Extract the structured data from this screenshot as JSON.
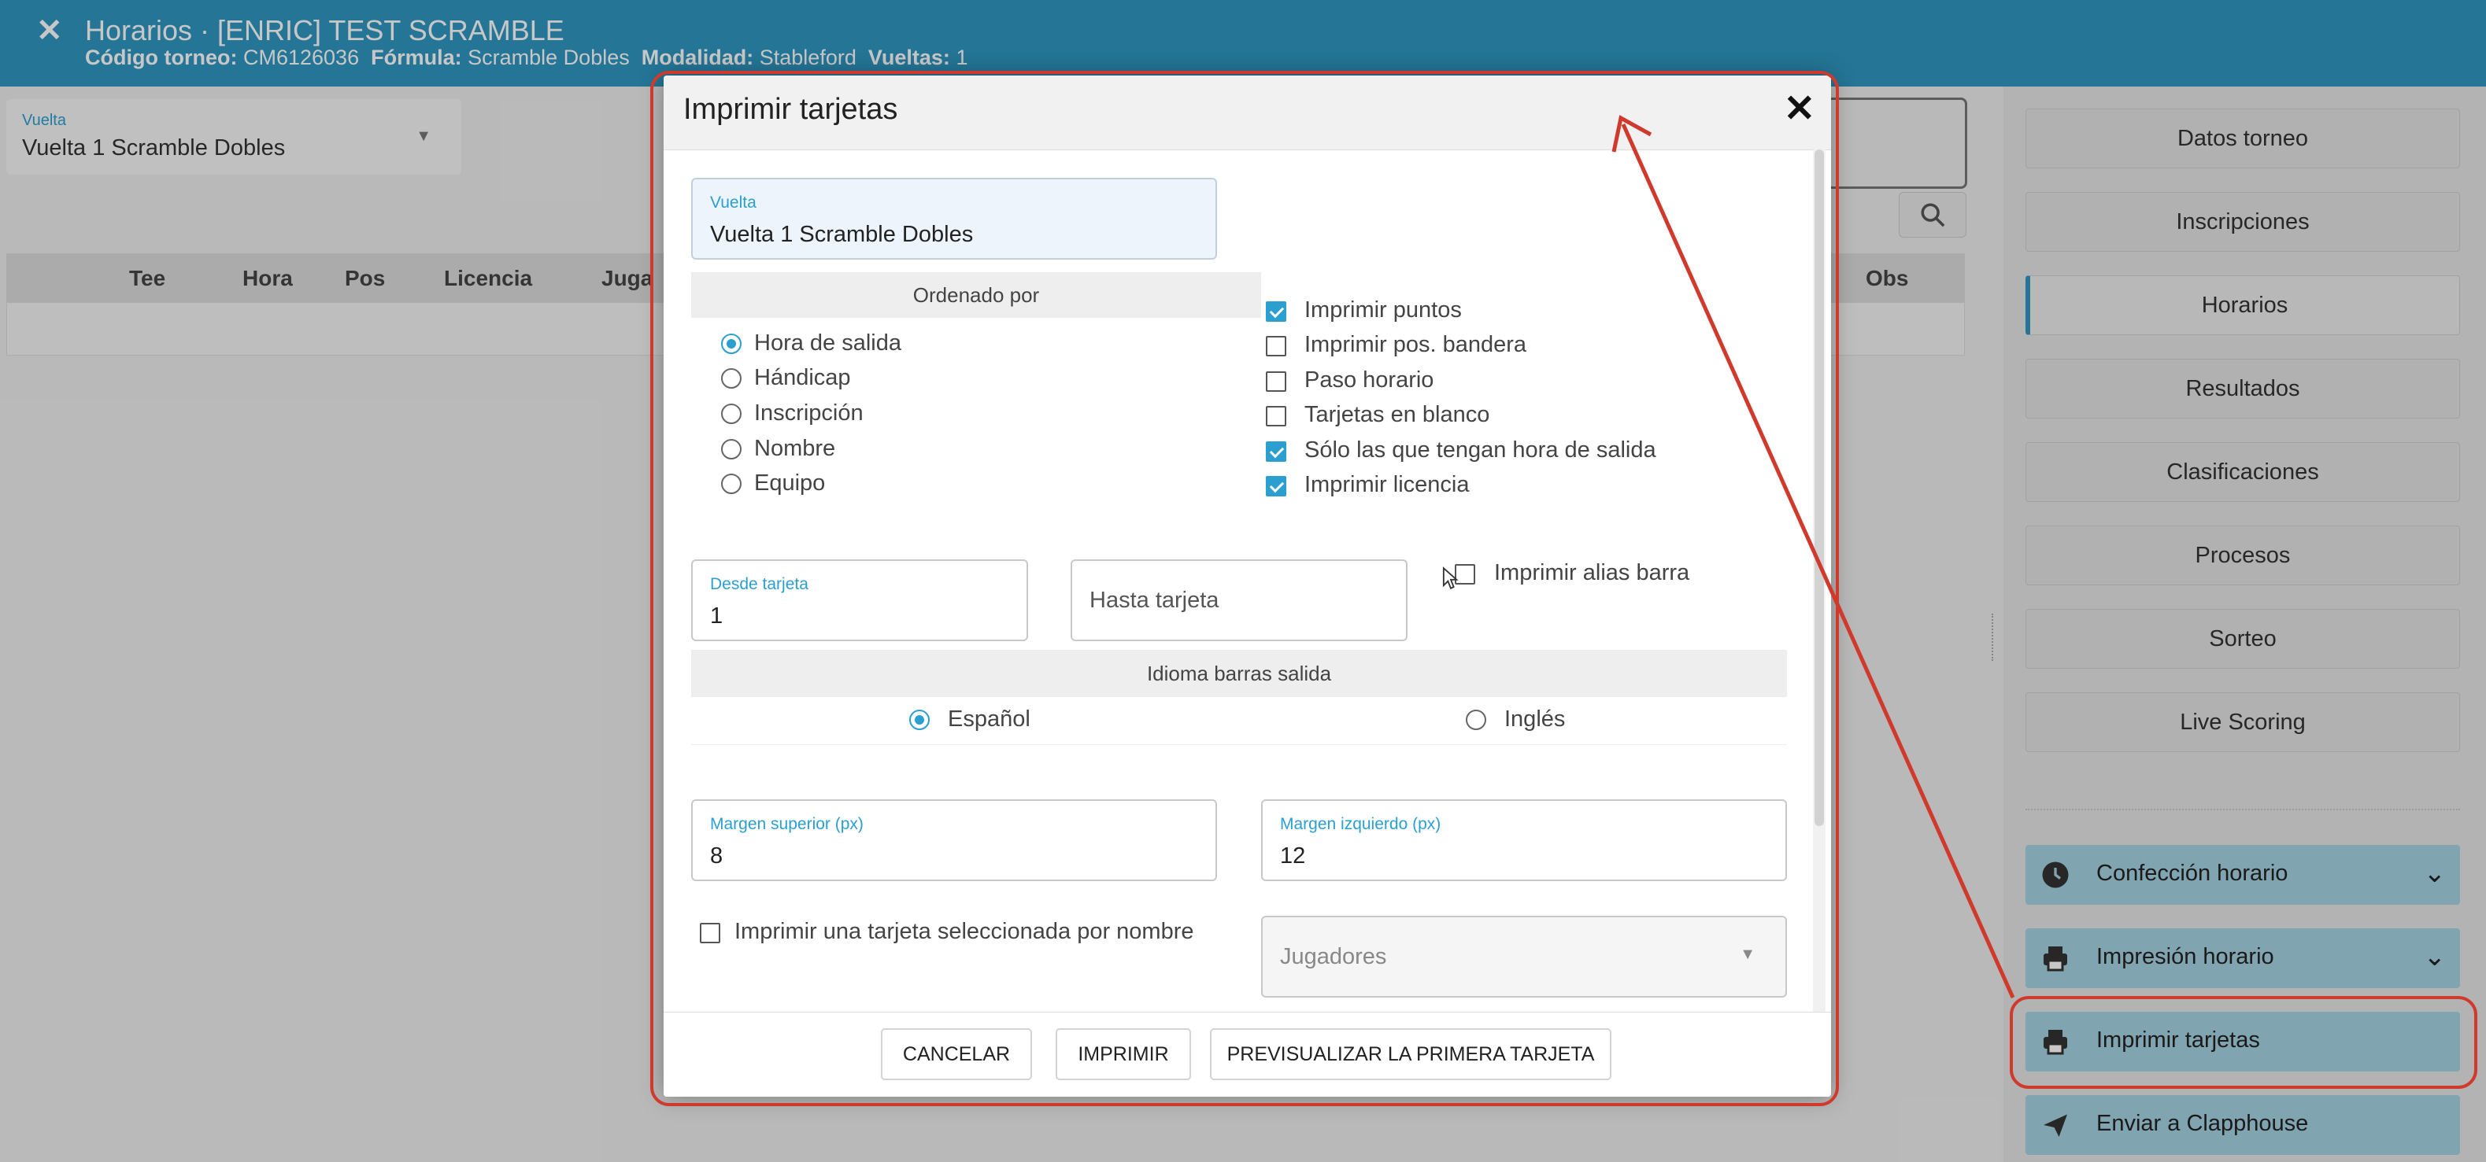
{
  "header": {
    "close_glyph": "✕",
    "title": "Horarios · [ENRIC] TEST SCRAMBLE",
    "codigo_label": "Código torneo:",
    "codigo_value": "CM6126036",
    "formula_label": "Fórmula:",
    "formula_value": "Scramble Dobles",
    "modalidad_label": "Modalidad:",
    "modalidad_value": "Stableford",
    "vueltas_label": "Vueltas:",
    "vueltas_value": "1"
  },
  "vuelta_select": {
    "label": "Vuelta",
    "value": "Vuelta 1 Scramble Dobles"
  },
  "grid": {
    "columns": [
      "Tee",
      "Hora",
      "Pos",
      "Licencia",
      "Juga",
      "Obs"
    ]
  },
  "sidebar": {
    "buttons": [
      "Datos torneo",
      "Inscripciones",
      "Horarios",
      "Resultados",
      "Clasificaciones",
      "Procesos",
      "Sorteo",
      "Live Scoring"
    ],
    "active": "Horarios",
    "actions": [
      {
        "label": "Confección horario",
        "icon": "clock-icon"
      },
      {
        "label": "Impresión horario",
        "icon": "printer-icon"
      },
      {
        "label": "Imprimir tarjetas",
        "icon": "printer-icon"
      },
      {
        "label": "Enviar a Clapphouse",
        "icon": "send-icon"
      }
    ]
  },
  "modal": {
    "title": "Imprimir tarjetas",
    "vuelta": {
      "label": "Vuelta",
      "value": "Vuelta 1 Scramble Dobles"
    },
    "ordenado_por": {
      "title": "Ordenado por",
      "options": [
        "Hora de salida",
        "Hándicap",
        "Inscripción",
        "Nombre",
        "Equipo"
      ],
      "selected": "Hora de salida"
    },
    "checks": [
      {
        "label": "Imprimir puntos",
        "checked": true
      },
      {
        "label": "Imprimir pos. bandera",
        "checked": false
      },
      {
        "label": "Paso horario",
        "checked": false
      },
      {
        "label": "Tarjetas en blanco",
        "checked": false
      },
      {
        "label": "Sólo las que tengan hora de salida",
        "checked": true
      },
      {
        "label": "Imprimir licencia",
        "checked": true
      }
    ],
    "desde_tarjeta": {
      "label": "Desde tarjeta",
      "value": "1"
    },
    "hasta_tarjeta": {
      "placeholder": "Hasta tarjeta"
    },
    "alias_barra": {
      "label": "Imprimir alias barra",
      "checked": false
    },
    "idioma": {
      "title": "Idioma barras salida",
      "options": [
        "Español",
        "Inglés"
      ],
      "selected": "Español"
    },
    "margen_superior": {
      "label": "Margen superior (px)",
      "value": "8"
    },
    "margen_izquierdo": {
      "label": "Margen izquierdo (px)",
      "value": "12"
    },
    "una_tarjeta": {
      "label": "Imprimir una tarjeta seleccionada por nombre",
      "checked": false
    },
    "jugadores": {
      "placeholder": "Jugadores"
    },
    "buttons": {
      "cancel": "CANCELAR",
      "print": "IMPRIMIR",
      "preview": "PREVISUALIZAR LA PRIMERA TARJETA"
    }
  },
  "colors": {
    "accent": "#2f97c1",
    "annotation": "#d03a2c",
    "action_bg": "#a6d2e3"
  }
}
